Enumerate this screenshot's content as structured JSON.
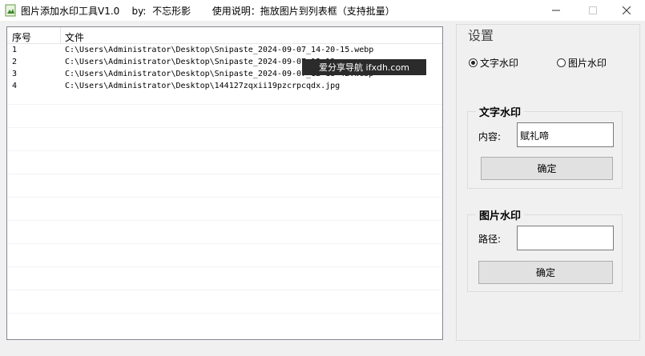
{
  "window": {
    "title": "图片添加水印工具V1.0    by:  不忘形影       使用说明：拖放图片到列表框（支持批量）",
    "minimize_icon": "minimize-icon",
    "maximize_icon": "maximize-icon",
    "close_icon": "close-icon"
  },
  "list": {
    "columns": [
      "序号",
      "文件"
    ],
    "rows": [
      {
        "seq": "1",
        "path": "C:\\Users\\Administrator\\Desktop\\Snipaste_2024-09-07_14-20-15.webp"
      },
      {
        "seq": "2",
        "path": "C:\\Users\\Administrator\\Desktop\\Snipaste_2024-09-07_12-13-"
      },
      {
        "seq": "3",
        "path": "C:\\Users\\Administrator\\Desktop\\Snipaste_2024-09-07_12-18-42.webp"
      },
      {
        "seq": "4",
        "path": "C:\\Users\\Administrator\\Desktop\\144127zqxii19pzcrpcqdx.jpg"
      }
    ]
  },
  "overlay": {
    "text": "爱分享导航 ifxdh.com"
  },
  "settings": {
    "title": "设置",
    "radio_text": "文字水印",
    "radio_image": "图片水印",
    "selected": "text",
    "text_group": {
      "title": "文字水印",
      "content_label": "内容:",
      "content_value": "赋礼啼",
      "confirm_label": "确定"
    },
    "image_group": {
      "title": "图片水印",
      "path_label": "路径:",
      "path_value": "",
      "confirm_label": "确定"
    }
  }
}
